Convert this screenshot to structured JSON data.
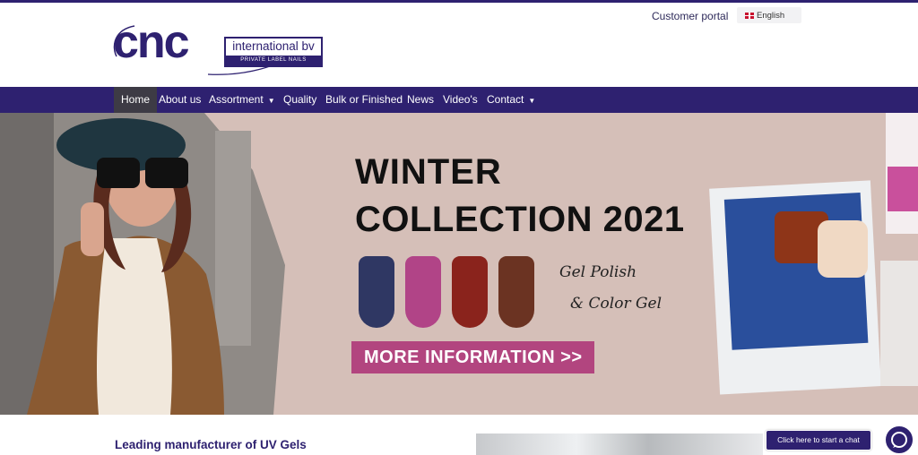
{
  "header": {
    "customer_portal": "Customer portal",
    "language": "English",
    "logo": {
      "brand": "cnc",
      "tagline": "international bv",
      "subline": "PRIVATE LABEL NAILS"
    }
  },
  "nav": {
    "items": [
      {
        "label": "Home",
        "active": true
      },
      {
        "label": "About us"
      },
      {
        "label": "Assortment",
        "dropdown": true
      },
      {
        "label": "Quality"
      },
      {
        "label": "Bulk or Finished"
      },
      {
        "label": "News"
      },
      {
        "label": "Video's"
      },
      {
        "label": "Contact",
        "dropdown": true
      }
    ]
  },
  "hero": {
    "title_line1": "WINTER",
    "title_line2": "COLLECTION 2021",
    "script_line1": "Gel Polish",
    "script_line2": "& Color Gel",
    "cta": "MORE INFORMATION >>",
    "nail_colors": [
      "#2f3763",
      "#b14487",
      "#8a231c",
      "#6b3322"
    ]
  },
  "intro": {
    "title": "Leading manufacturer of UV Gels"
  },
  "chat": {
    "label": "Click here to start a chat"
  },
  "colors": {
    "brand": "#2e2170",
    "accent": "#b2457f",
    "hero_bg": "#d5bfb8"
  }
}
